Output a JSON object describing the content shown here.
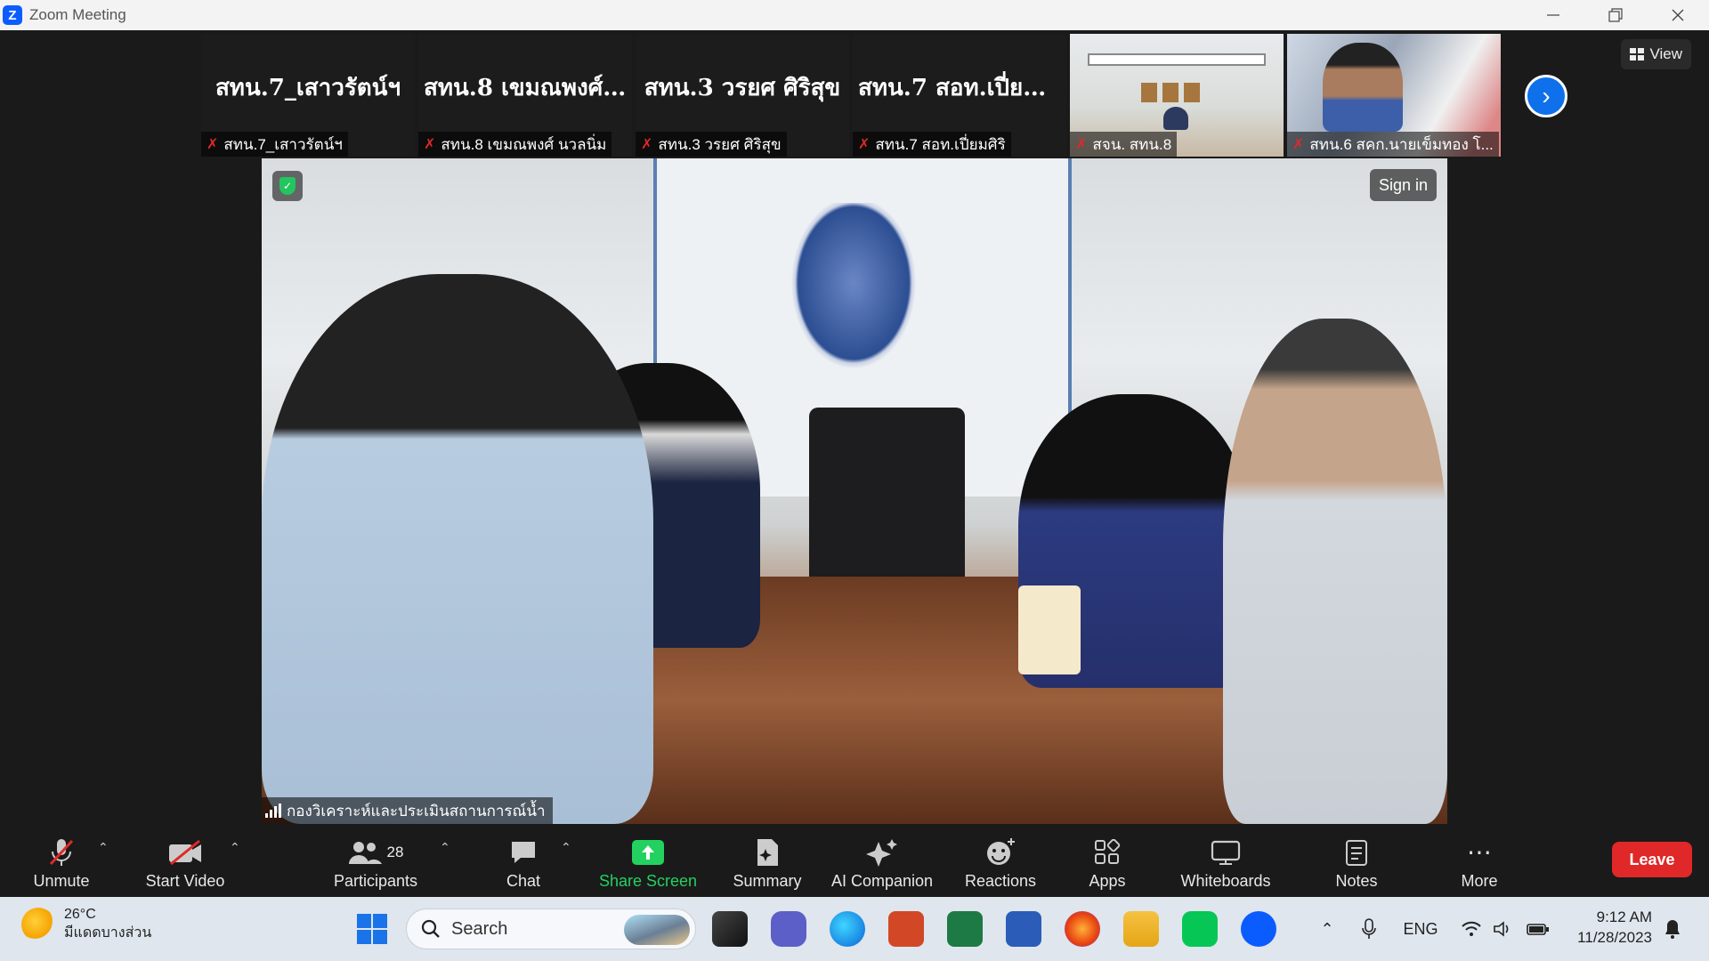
{
  "window": {
    "title": "Zoom Meeting",
    "controls": [
      "minimize",
      "restore",
      "close"
    ]
  },
  "strip": {
    "tiles": [
      {
        "display": "สทน.7_เสาวรัตน์ฯ",
        "label": "สทน.7_เสาวรัตน์ฯ",
        "type": "name"
      },
      {
        "display": "สทน.8 เขมณพงศ์...",
        "label": "สทน.8 เขมณพงศ์ นวลนิ่ม",
        "type": "name"
      },
      {
        "display": "สทน.3 วรยศ ศิริสุข",
        "label": "สทน.3 วรยศ ศิริสุข",
        "type": "name"
      },
      {
        "display": "สทน.7 สอท.เปี่ยม...",
        "label": "สทน.7 สอท.เปี่ยมศิริ",
        "type": "name"
      },
      {
        "display": "",
        "label": "สจน. สทน.8",
        "type": "video"
      },
      {
        "display": "",
        "label": "สทน.6 สคก.นายเข็มทอง โ...",
        "type": "video"
      }
    ],
    "view_label": "View"
  },
  "main_video": {
    "speaker_name": "กองวิเคราะห์และประเมินสถานการณ์น้ำ",
    "sign_in_label": "Sign in"
  },
  "toolbar": {
    "unmute": "Unmute",
    "start_video": "Start Video",
    "participants": "Participants",
    "participant_count": "28",
    "chat": "Chat",
    "share_screen": "Share Screen",
    "summary": "Summary",
    "ai_companion": "AI Companion",
    "reactions": "Reactions",
    "apps": "Apps",
    "whiteboards": "Whiteboards",
    "notes": "Notes",
    "more": "More",
    "leave": "Leave"
  },
  "taskbar": {
    "weather_temp": "26°C",
    "weather_desc": "มีแดดบางส่วน",
    "search_placeholder": "Search",
    "language": "ENG",
    "time": "9:12 AM",
    "date": "11/28/2023"
  },
  "colors": {
    "accent": "#0e71eb",
    "leave": "#e02828",
    "share": "#23d160",
    "muted": "#e02828"
  }
}
